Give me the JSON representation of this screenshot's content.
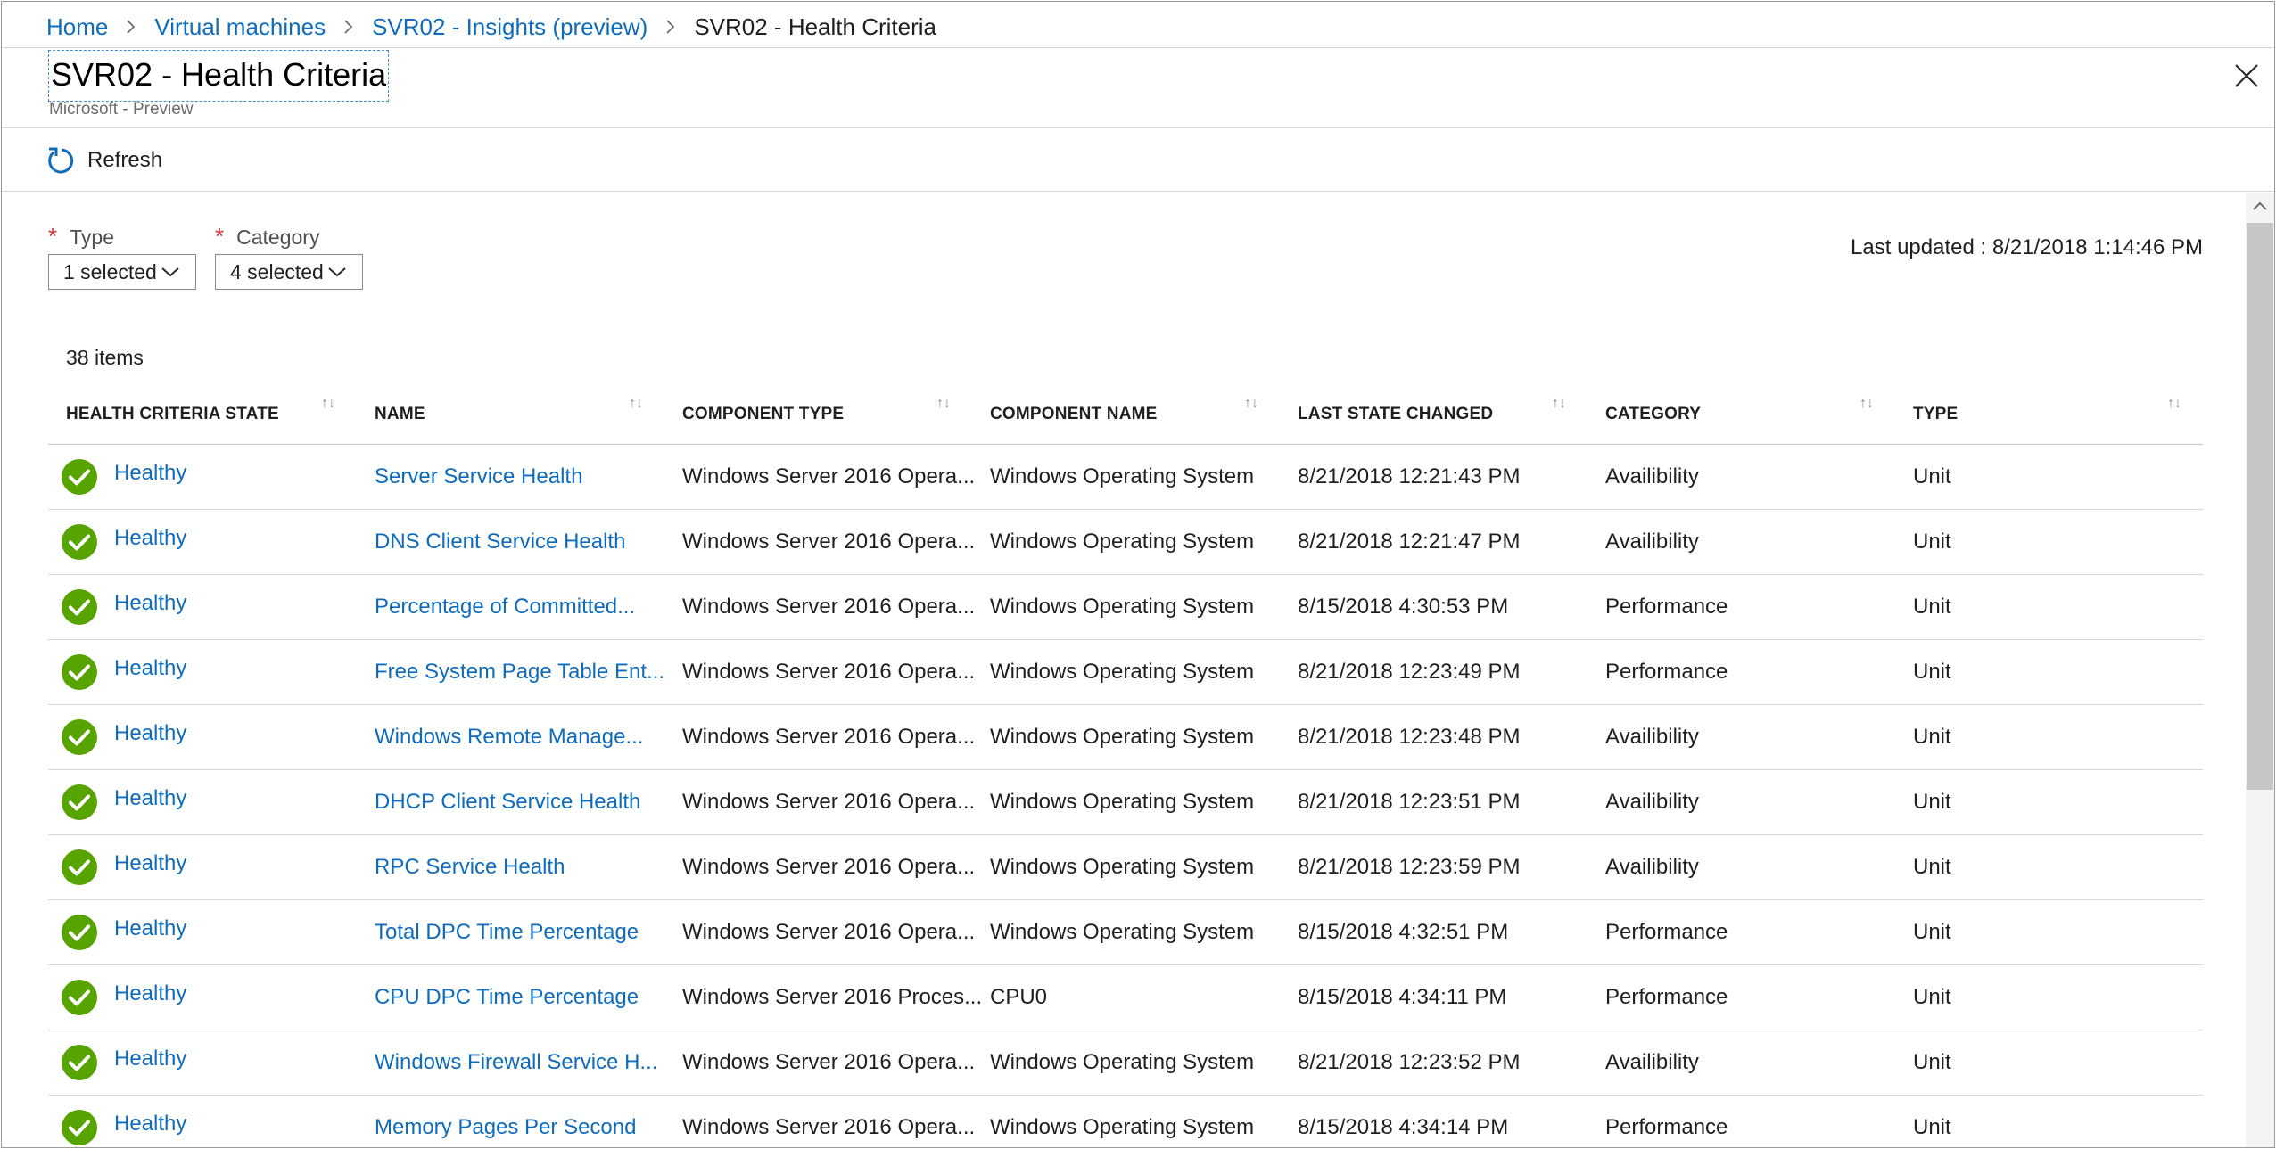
{
  "breadcrumb": {
    "items": [
      {
        "label": "Home",
        "link": true
      },
      {
        "label": "Virtual machines",
        "link": true
      },
      {
        "label": "SVR02 - Insights (preview)",
        "link": true
      },
      {
        "label": "SVR02 - Health Criteria",
        "link": false
      }
    ]
  },
  "header": {
    "title": "SVR02 - Health Criteria",
    "subtitle": "Microsoft - Preview"
  },
  "toolbar": {
    "refresh_label": "Refresh"
  },
  "filters": {
    "type": {
      "label": "Type",
      "required": "*",
      "value": "1 selected"
    },
    "category": {
      "label": "Category",
      "required": "*",
      "value": "4 selected"
    }
  },
  "last_updated": "Last updated : 8/21/2018 1:14:46 PM",
  "items_count": "38 items",
  "table": {
    "columns": [
      "HEALTH CRITERIA STATE",
      "NAME",
      "COMPONENT TYPE",
      "COMPONENT NAME",
      "LAST STATE CHANGED",
      "CATEGORY",
      "TYPE"
    ],
    "rows": [
      {
        "state": "Healthy",
        "name": "Server Service Health",
        "component_type": "Windows Server 2016 Opera...",
        "component_name": "Windows Operating System",
        "last_changed": "8/21/2018 12:21:43 PM",
        "category": "Availibility",
        "type": "Unit"
      },
      {
        "state": "Healthy",
        "name": "DNS Client Service Health",
        "component_type": "Windows Server 2016 Opera...",
        "component_name": "Windows Operating System",
        "last_changed": "8/21/2018 12:21:47 PM",
        "category": "Availibility",
        "type": "Unit"
      },
      {
        "state": "Healthy",
        "name": "Percentage of Committed...",
        "component_type": "Windows Server 2016 Opera...",
        "component_name": "Windows Operating System",
        "last_changed": "8/15/2018 4:30:53 PM",
        "category": "Performance",
        "type": "Unit"
      },
      {
        "state": "Healthy",
        "name": "Free System Page Table Ent...",
        "component_type": "Windows Server 2016 Opera...",
        "component_name": "Windows Operating System",
        "last_changed": "8/21/2018 12:23:49 PM",
        "category": "Performance",
        "type": "Unit"
      },
      {
        "state": "Healthy",
        "name": "Windows Remote Manage...",
        "component_type": "Windows Server 2016 Opera...",
        "component_name": "Windows Operating System",
        "last_changed": "8/21/2018 12:23:48 PM",
        "category": "Availibility",
        "type": "Unit"
      },
      {
        "state": "Healthy",
        "name": "DHCP Client Service Health",
        "component_type": "Windows Server 2016 Opera...",
        "component_name": "Windows Operating System",
        "last_changed": "8/21/2018 12:23:51 PM",
        "category": "Availibility",
        "type": "Unit"
      },
      {
        "state": "Healthy",
        "name": "RPC Service Health",
        "component_type": "Windows Server 2016 Opera...",
        "component_name": "Windows Operating System",
        "last_changed": "8/21/2018 12:23:59 PM",
        "category": "Availibility",
        "type": "Unit"
      },
      {
        "state": "Healthy",
        "name": "Total DPC Time Percentage",
        "component_type": "Windows Server 2016 Opera...",
        "component_name": "Windows Operating System",
        "last_changed": "8/15/2018 4:32:51 PM",
        "category": "Performance",
        "type": "Unit"
      },
      {
        "state": "Healthy",
        "name": "CPU DPC Time Percentage",
        "component_type": "Windows Server 2016 Proces...",
        "component_name": "CPU0",
        "last_changed": "8/15/2018 4:34:11 PM",
        "category": "Performance",
        "type": "Unit"
      },
      {
        "state": "Healthy",
        "name": "Windows Firewall Service H...",
        "component_type": "Windows Server 2016 Opera...",
        "component_name": "Windows Operating System",
        "last_changed": "8/21/2018 12:23:52 PM",
        "category": "Availibility",
        "type": "Unit"
      },
      {
        "state": "Healthy",
        "name": "Memory Pages Per Second",
        "component_type": "Windows Server 2016 Opera...",
        "component_name": "Windows Operating System",
        "last_changed": "8/15/2018 4:34:14 PM",
        "category": "Performance",
        "type": "Unit"
      }
    ]
  },
  "colors": {
    "link": "#0f6cbd",
    "healthy": "#57a300",
    "required": "#d13438"
  },
  "icons": {
    "status": "check-circle-icon",
    "refresh": "refresh-icon",
    "close": "close-icon",
    "dropdown": "chevron-down-icon",
    "breadcrumb_sep": "chevron-right-icon",
    "sort": "sort-icon"
  }
}
